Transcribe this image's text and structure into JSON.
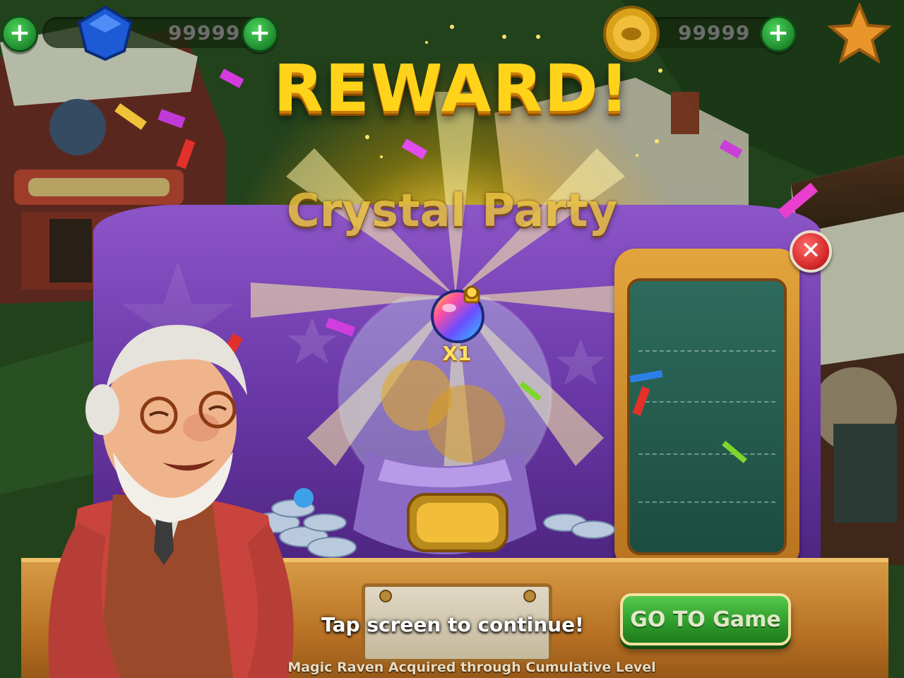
{
  "hud": {
    "gems": "99999",
    "coins": "99999",
    "plus": "+",
    "icons": {
      "gem": "blue-gem-icon",
      "coin": "gold-coin-icon",
      "star": "star-icon"
    }
  },
  "popup": {
    "title": "REWARD!",
    "subtitle": "Crystal Party",
    "reward_item": {
      "icon": "rainbow-potion-icon",
      "count": "X1"
    },
    "close": "✕"
  },
  "actions": {
    "go_label": "GO TO Game",
    "tap_hint": "Tap screen to continue!"
  },
  "footer": "Magic Raven Acquired through Cumulative Level",
  "colors": {
    "title": "#ffd31a",
    "banner": "#6b39a8",
    "go_button": "#2e9a2a",
    "board": "#1c4d40",
    "close_button": "#d32727"
  }
}
